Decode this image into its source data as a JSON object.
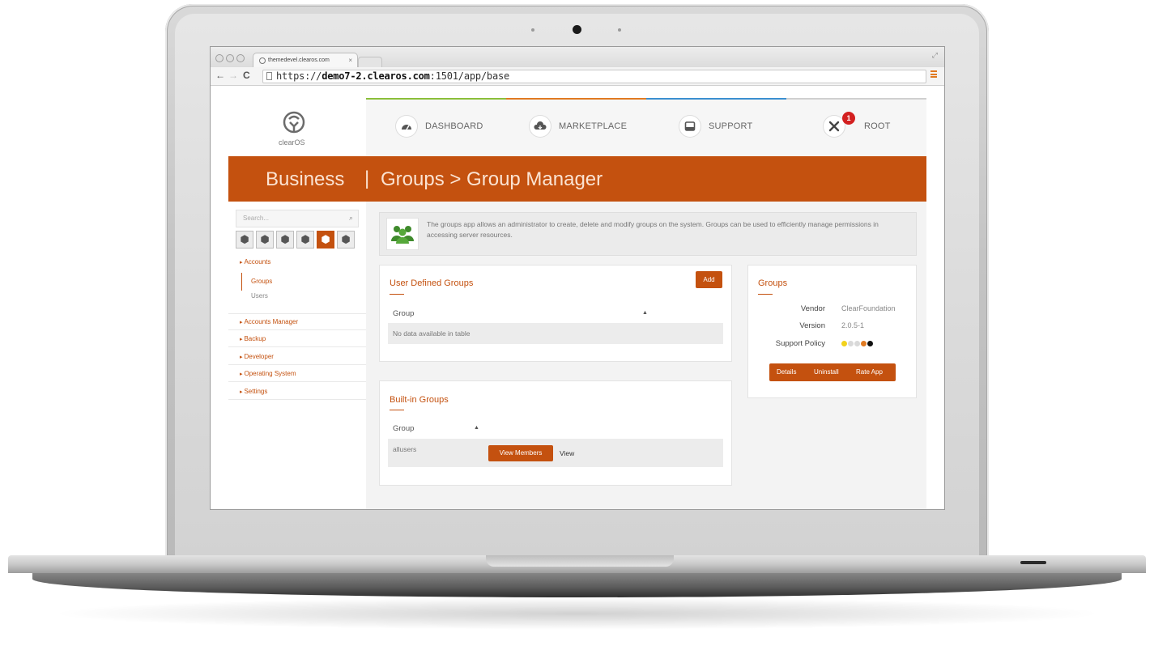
{
  "browser": {
    "tab_title": "themedevel.clearos.com",
    "tab_close": "×",
    "url_scheme": "https://",
    "url_domain": "demo7-2.clearos.com",
    "url_rest": ":1501/app/base"
  },
  "app": {
    "logo_text": "clearOS",
    "nav": [
      {
        "label": "DASHBOARD",
        "icon": "dashboard-gauge-icon"
      },
      {
        "label": "MARKETPLACE",
        "icon": "cloud-download-icon"
      },
      {
        "label": "SUPPORT",
        "icon": "inbox-icon"
      },
      {
        "label": "ROOT",
        "icon": "tools-icon",
        "badge": "1"
      }
    ],
    "stripe_colors": [
      "#8bbf3a",
      "#e07a22",
      "#3b8fd0",
      "#cfcfcf"
    ],
    "accent_color": "#c4510f"
  },
  "banner": {
    "section": "Business",
    "separator": "|",
    "breadcrumb": "Groups > Group Manager"
  },
  "sidebar": {
    "search_placeholder": "Search...",
    "search_icon": "🔍",
    "categories": [
      {
        "label": "Accounts",
        "expanded": true,
        "children": [
          "Groups",
          "Users"
        ],
        "active_child": "Groups"
      },
      {
        "label": "Accounts Manager"
      },
      {
        "label": "Backup"
      },
      {
        "label": "Developer"
      },
      {
        "label": "Operating System"
      },
      {
        "label": "Settings"
      }
    ],
    "category_cubes": 6,
    "active_cube_index": 4
  },
  "info": {
    "icon": "users-group-icon",
    "text": "The groups app allows an administrator to create, delete and modify groups on the system. Groups can be used to efficiently manage permissions in accessing server resources."
  },
  "user_defined": {
    "title": "User Defined Groups",
    "add_label": "Add",
    "column": "Group",
    "empty_text": "No data available in table"
  },
  "builtin": {
    "title": "Built-in Groups",
    "column": "Group",
    "rows": [
      {
        "name": "allusers",
        "view_members": "View Members",
        "view": "View"
      }
    ]
  },
  "groups_info": {
    "title": "Groups",
    "vendor_label": "Vendor",
    "vendor": "ClearFoundation",
    "version_label": "Version",
    "version": "2.0.5-1",
    "support_label": "Support Policy",
    "support_dots": [
      "#f2d21c",
      "#d9d9d9",
      "#d9d9d9",
      "#e07a22",
      "#111111"
    ],
    "buttons": [
      "Details",
      "Uninstall",
      "Rate App"
    ]
  }
}
